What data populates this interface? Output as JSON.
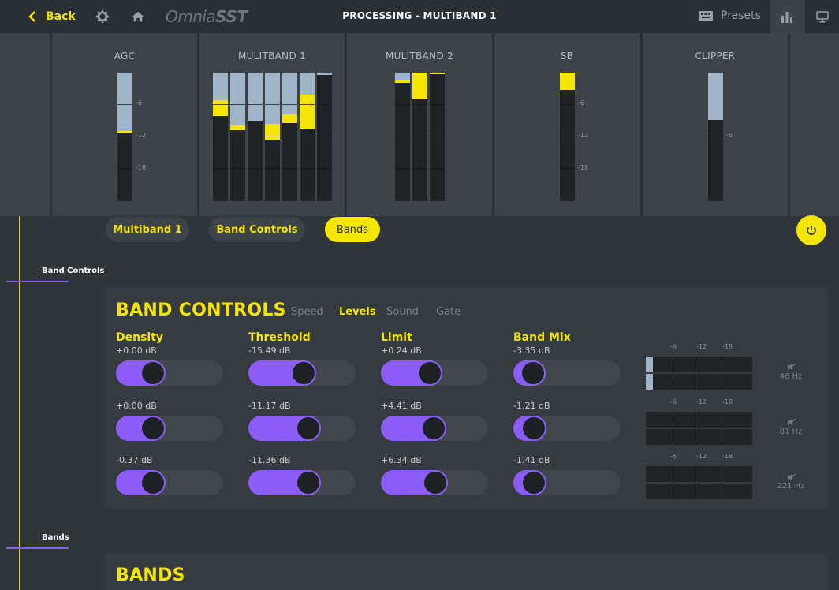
{
  "topbar": {
    "back_label": "Back",
    "logo_light": "Omnia",
    "logo_bold": "SST",
    "title": "PROCESSING - MULTIBAND 1",
    "presets_label": "Presets"
  },
  "meters": {
    "agc": {
      "title": "AGC",
      "ticks": [
        "-6",
        "-12",
        "-18"
      ]
    },
    "mb1": {
      "title": "MULITBAND 1"
    },
    "mb2": {
      "title": "MULITBAND 2"
    },
    "sb": {
      "title": "SB",
      "ticks": [
        "-6",
        "-12",
        "-18"
      ]
    },
    "clipper": {
      "title": "CLIPPER",
      "ticks": [
        "-6"
      ]
    }
  },
  "tabs": [
    "Multiband 1",
    "Band Controls",
    "Bands"
  ],
  "rail": {
    "band_controls": "Band Controls",
    "bands": "Bands"
  },
  "band_controls": {
    "title": "BAND CONTROLS",
    "subtabs": [
      "Speed",
      "Levels",
      "Sound",
      "Gate"
    ],
    "params": [
      "Density",
      "Threshold",
      "Limit",
      "Band Mix"
    ],
    "rows": [
      {
        "values": [
          "+0.00 dB",
          "-15.49 dB",
          "+0.24 dB",
          "-3.35 dB"
        ],
        "hz": "46 Hz"
      },
      {
        "values": [
          "+0.00 dB",
          "-11.17 dB",
          "+4.41 dB",
          "-1.21 dB"
        ],
        "hz": "81 Hz"
      },
      {
        "values": [
          "-0.37 dB",
          "-11.36 dB",
          "+6.34 dB",
          "-1.41 dB"
        ],
        "hz": "221 Hz"
      }
    ],
    "meter_ticks": [
      "-6",
      "-12",
      "-18"
    ]
  },
  "bands": {
    "title": "BANDS"
  },
  "colors": {
    "accent": "#f4e600",
    "slider": "#8b5cf6",
    "meter_fill": "#9fb4c6"
  }
}
